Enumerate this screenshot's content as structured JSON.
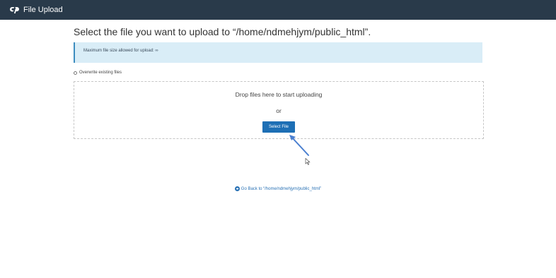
{
  "header": {
    "logo_icon": "cpanel-logo-icon",
    "title": "File Upload"
  },
  "main": {
    "heading": "Select the file you want to upload to “/home/ndmehjym/public_html”.",
    "info_text": "Maximum file size allowed for upload: ∞",
    "overwrite_label": "Overwrite existing files",
    "overwrite_checked": false,
    "dropzone": {
      "drop_text": "Drop files here to start uploading",
      "or_text": "or",
      "select_button_label": "Select File"
    },
    "go_back_label": "Go Back to “/home/ndmehjym/public_html”"
  },
  "colors": {
    "topbar": "#293a4a",
    "info_bg": "#d9edf7",
    "info_border": "#3d8dbf",
    "button": "#1d6fb5",
    "link": "#2a72b5",
    "annotation_arrow": "#4a7fd0"
  }
}
